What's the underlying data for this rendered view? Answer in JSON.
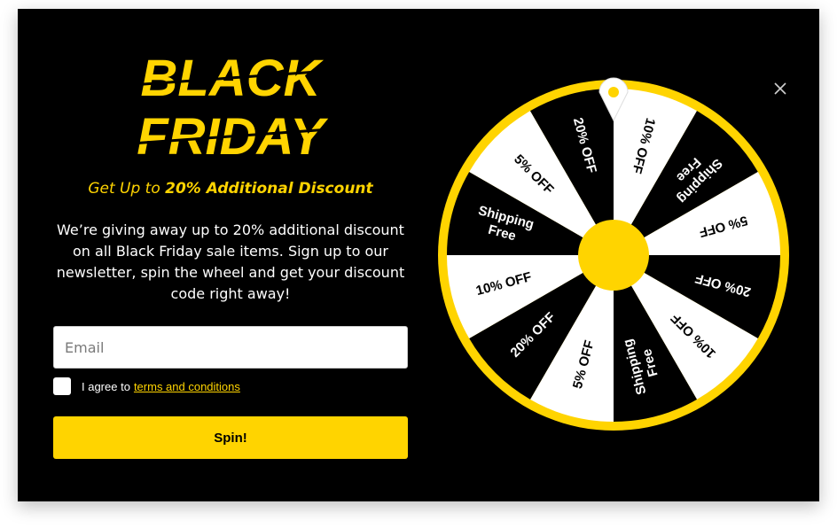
{
  "logo": {
    "line1": "BLACK",
    "line2": "FRIDAY"
  },
  "subtitle": {
    "prefix": "Get Up to",
    "highlight": "20% Additional Discount"
  },
  "description": "We’re giving away up to 20% additional discount on all Black Friday sale items. Sign up to our newsletter, spin the wheel and get your discount code right away!",
  "form": {
    "email_placeholder": "Email",
    "agree_prefix": "I agree to",
    "terms_label": "terms and conditions",
    "spin_label": "Spin!"
  },
  "wheel": {
    "segments": [
      {
        "label": "10% OFF",
        "color": "white"
      },
      {
        "label": "Free Shipping",
        "color": "black"
      },
      {
        "label": "5% OFF",
        "color": "white"
      },
      {
        "label": "20% OFF",
        "color": "black"
      },
      {
        "label": "10% OFF",
        "color": "white"
      },
      {
        "label": "Free Shipping",
        "color": "black"
      },
      {
        "label": "5% OFF",
        "color": "white"
      },
      {
        "label": "20% OFF",
        "color": "black"
      },
      {
        "label": "10% OFF",
        "color": "white"
      },
      {
        "label": "Free Shipping",
        "color": "black"
      },
      {
        "label": "5% OFF",
        "color": "white"
      },
      {
        "label": "20% OFF",
        "color": "black"
      }
    ]
  },
  "colors": {
    "accent": "#ffd400",
    "background": "#000000",
    "panel": "#ffffff"
  },
  "icons": {
    "close": "close-icon",
    "pointer": "map-pin-icon"
  }
}
